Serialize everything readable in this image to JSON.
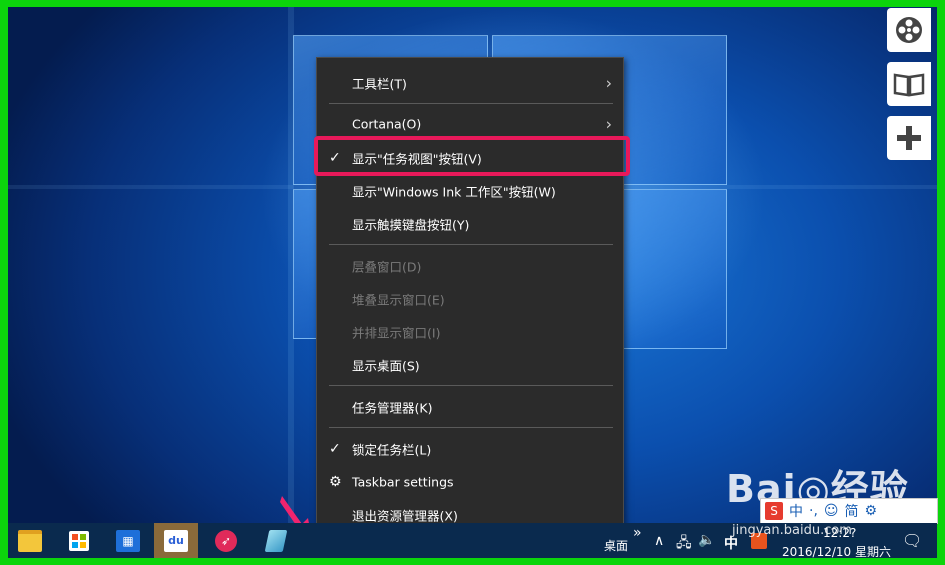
{
  "menu": {
    "items": [
      {
        "label": "工具栏(T)",
        "has_submenu": true
      },
      {
        "label": "Cortana(O)",
        "has_submenu": true
      },
      {
        "label": "显示\"任务视图\"按钮(V)",
        "checked": true
      },
      {
        "label": "显示\"Windows Ink 工作区\"按钮(W)"
      },
      {
        "label": "显示触摸键盘按钮(Y)"
      },
      {
        "label": "层叠窗口(D)",
        "disabled": true
      },
      {
        "label": "堆叠显示窗口(E)",
        "disabled": true
      },
      {
        "label": "并排显示窗口(I)",
        "disabled": true
      },
      {
        "label": "显示桌面(S)"
      },
      {
        "label": "任务管理器(K)"
      },
      {
        "label": "锁定任务栏(L)",
        "checked": true
      },
      {
        "label": "Taskbar settings",
        "icon": "gear-icon"
      },
      {
        "label": "退出资源管理器(X)"
      }
    ],
    "check_glyph": "✓",
    "arrow_glyph": "›"
  },
  "taskbar": {
    "desktop_label": "桌面",
    "overflow_glyph": "»",
    "tray_up_glyph": "∧",
    "ime_lang": "中",
    "time": "12:2?",
    "date": "2016/12/10 星期六",
    "apps": [
      "file-explorer-icon",
      "store-icon",
      "office-icon",
      "baidu-icon",
      "pen-app-icon",
      "notepad-icon"
    ]
  },
  "ime_bar": {
    "s_label": "S",
    "items": [
      "中",
      "·,",
      "☺",
      "简",
      "⚙"
    ]
  },
  "watermark": {
    "text": "Bai◎经验",
    "sub": "jingyan.baidu.com"
  },
  "side_buttons": [
    "film-reel-icon",
    "book-icon",
    "plus-icon"
  ],
  "colors": {
    "highlight": "#e8195a",
    "frame": "#0cd40c",
    "menu_bg": "#2b2b2b",
    "taskbar_bg": "#0a2a4e"
  }
}
